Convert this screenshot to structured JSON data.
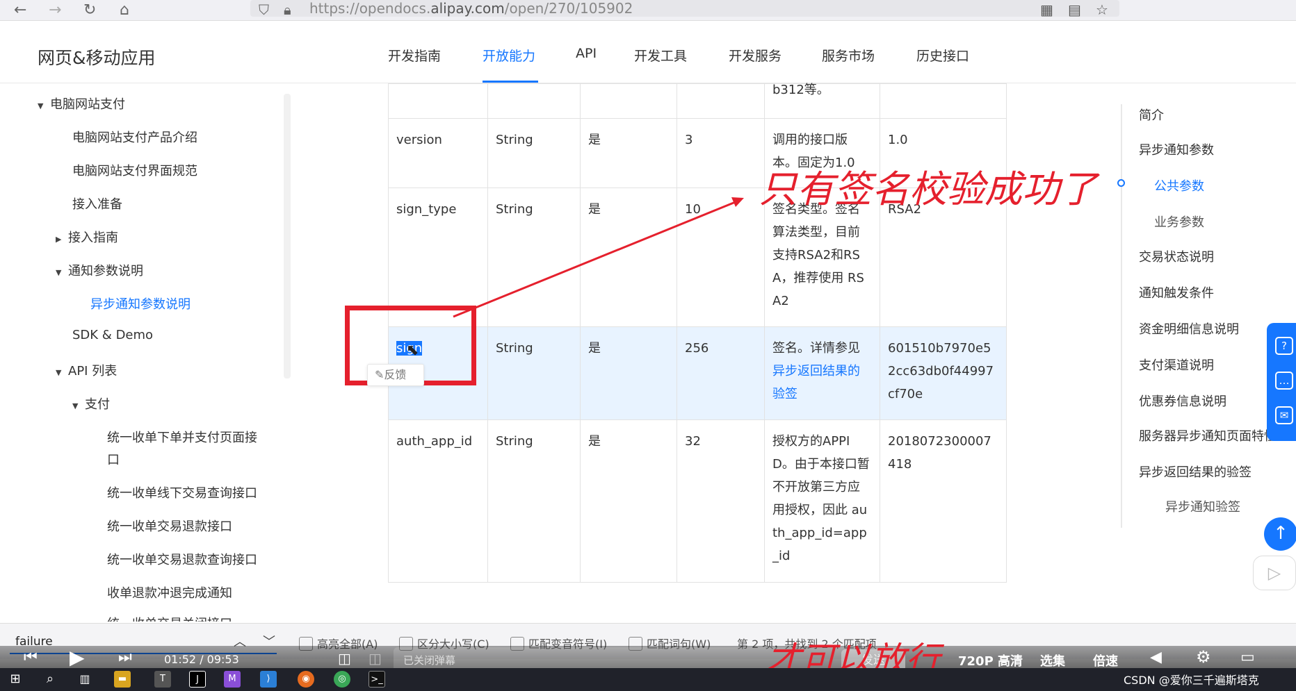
{
  "browser": {
    "url_prefix": "https://opendocs.",
    "url_domain": "alipay.com",
    "url_path": "/open/270/105902"
  },
  "header": {
    "site_title": "网页&移动应用",
    "nav": [
      "开发指南",
      "开放能力",
      "API",
      "开发工具",
      "开发服务",
      "服务市场",
      "历史接口"
    ],
    "active_nav": "开放能力"
  },
  "sidebar": {
    "items": [
      {
        "label": "电脑网站支付",
        "caret": "▼"
      },
      {
        "label": "电脑网站支付产品介绍",
        "caret": ""
      },
      {
        "label": "电脑网站支付界面规范",
        "caret": ""
      },
      {
        "label": "接入准备",
        "caret": ""
      },
      {
        "label": "接入指南",
        "caret": "▶"
      },
      {
        "label": "通知参数说明",
        "caret": "▼"
      },
      {
        "label": "异步通知参数说明",
        "caret": ""
      },
      {
        "label": "SDK & Demo",
        "caret": ""
      },
      {
        "label": "API 列表",
        "caret": "▼"
      },
      {
        "label": "支付",
        "caret": "▼"
      },
      {
        "label": "统一收单下单并支付页面接",
        "caret": ""
      },
      {
        "label": "口",
        "caret": ""
      },
      {
        "label": "统一收单线下交易查询接口",
        "caret": ""
      },
      {
        "label": "统一收单交易退款接口",
        "caret": ""
      },
      {
        "label": "统一收单交易退款查询接口",
        "caret": ""
      },
      {
        "label": "收单退款冲退完成通知",
        "caret": ""
      },
      {
        "label": "统一收单交易关闭接口",
        "caret": ""
      }
    ]
  },
  "table": {
    "top_fragment": "b312等。",
    "rows": [
      {
        "name": "version",
        "type": "String",
        "required": "是",
        "maxlen": "3",
        "desc": "调用的接口版本。固定为1.0",
        "example": "1.0"
      },
      {
        "name": "sign_type",
        "type": "String",
        "required": "是",
        "maxlen": "10",
        "desc": "签名类型。签名算法类型，目前支持RSA2和RSA，推荐使用 RSA2",
        "example": "RSA2"
      },
      {
        "name": "sign",
        "type": "String",
        "required": "是",
        "maxlen": "256",
        "desc_prefix": "签名。详情参见 ",
        "desc_link": "异步返回结果的验签",
        "example": "601510b7970e52cc63db0f44997cf70e"
      },
      {
        "name": "auth_app_id",
        "type": "String",
        "required": "是",
        "maxlen": "32",
        "desc": "授权方的APPID。由于本接口暂不开放第三方应用授权，因此 auth_app_id=app_id",
        "example": "2018072300007418"
      }
    ],
    "feedback_label": "反馈"
  },
  "toc": {
    "items": [
      {
        "label": "简介",
        "level": 1
      },
      {
        "label": "异步通知参数",
        "level": 1
      },
      {
        "label": "公共参数",
        "level": 2,
        "active": true
      },
      {
        "label": "业务参数",
        "level": 2
      },
      {
        "label": "交易状态说明",
        "level": 1
      },
      {
        "label": "通知触发条件",
        "level": 1
      },
      {
        "label": "资金明细信息说明",
        "level": 1
      },
      {
        "label": "支付渠道说明",
        "level": 1
      },
      {
        "label": "优惠券信息说明",
        "level": 1
      },
      {
        "label": "服务器异步通知页面特性",
        "level": 1
      },
      {
        "label": "异步返回结果的验签",
        "level": 1
      },
      {
        "label": "异步通知验签",
        "level": 2
      }
    ]
  },
  "annotations": {
    "top": "只有签名校验成功了",
    "bottom": "才可以放行",
    "color": "#e5202d"
  },
  "find_bar": {
    "query": "failure",
    "options": [
      "高亮全部(A)",
      "区分大小写(C)",
      "匹配变音符号(I)",
      "匹配词句(W)"
    ],
    "status": "第 2 项，共找到 2 个匹配项"
  },
  "video": {
    "time": "01:52 / 09:53",
    "danmaku_placeholder": "已关闭弹幕",
    "send_label": "发送",
    "quality": "720P 高清",
    "episodes": "选集",
    "speed": "倍速"
  },
  "watermark": "CSDN @爱你三千遍斯塔克",
  "colors": {
    "accent": "#1677ff",
    "annotation": "#e5202d",
    "highlight_row": "#e8f3ff"
  }
}
